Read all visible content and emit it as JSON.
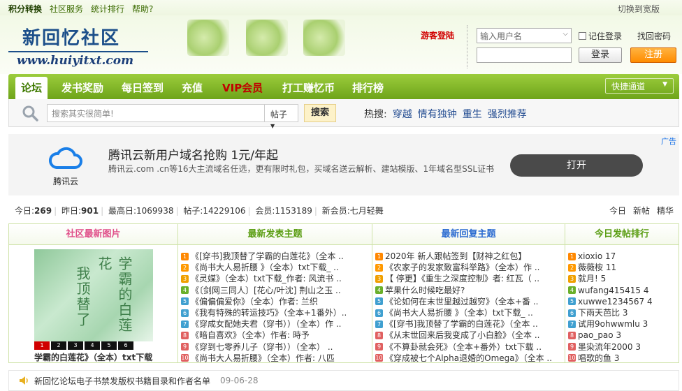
{
  "topbar": {
    "links": [
      "积分转换",
      "社区服务",
      "统计排行",
      "帮助?"
    ],
    "switch_label": "切换到宽版"
  },
  "logo": {
    "cn": "新回忆社区",
    "url": "www.huiyitxt.com"
  },
  "guest_login": "游客登陆",
  "login": {
    "username_placeholder": "输入用户名",
    "remember_label": "记住登录",
    "find_password": "找回密码",
    "login_button": "登录",
    "register_button": "注册"
  },
  "nav": {
    "items": [
      "论坛",
      "发书奖励",
      "每日签到",
      "充值",
      "VIP会员",
      "打工赚忆币",
      "排行榜"
    ],
    "quick_label": "快捷通道"
  },
  "search": {
    "placeholder": "搜索其实很简单!",
    "type_label": "帖子",
    "button": "搜索",
    "hot_label": "热搜:",
    "hot_keywords": [
      "穿越",
      "情有独钟",
      "重生",
      "强烈推荐"
    ]
  },
  "ad": {
    "tag": "广告",
    "brand": "腾讯云",
    "title": "腾讯云新用户域名抢购 1元/年起",
    "desc": "腾讯云.com .cn等16大主流域名任选，更有限时礼包，买域名送云解析、建站模版、1年域名型SSL证书",
    "open_button": "打开",
    "brand_color": "#1a7fe8"
  },
  "stats": {
    "today_label": "今日:",
    "today": "269",
    "yesterday_label": "昨日:",
    "yesterday": "901",
    "max_label": "最高日:",
    "max": "1069938",
    "posts_label": "帖子:",
    "posts": "14229106",
    "members_label": "会员:",
    "members": "1153189",
    "newest_label": "新会员:",
    "newest": "七月轻舞",
    "right_links": [
      "今日",
      "新帖",
      "精华"
    ]
  },
  "board": {
    "heads": [
      "社区最新图片",
      "最新发表主题",
      "最新回复主题",
      "今日发帖排行"
    ],
    "pic_title_1": "学霸的白莲花",
    "pic_title_2": "我顶替了",
    "pic_caption": "学霸的白莲花》（全本）txt下载",
    "pager": [
      "1",
      "2",
      "3",
      "4",
      "5",
      "6"
    ],
    "new_topics": [
      "《[穿书]我顶替了学霸的白莲花》（全本 ..",
      "《尚书大人易折腰 》（全本）txt下载_ ..",
      "《灵媒》（全本）txt下载_作者: 风流书 ..",
      "《〔剑网三同人〕[花心/叶沈] 荆山之玉 ..",
      "《偏偏偏爱你》（全本）作者: 兰织",
      "《我有特殊的转运技巧》（全本+1番外）..",
      "《穿成女配她夫君（穿书））（全本）作 ..",
      "《暗自喜欢》（全本）作者: 時予",
      "《穿到七零养儿子（穿书））（全本） ..",
      "《尚书大人易折腰》（全本）作者: 八匹"
    ],
    "new_replies": [
      "2020年 新人跟帖签到【财神之红包】",
      "《农家子的发家致富科举路》（全本）作 ..",
      "【 停更】《重生之深度控制》者: 红瓦（ ..",
      "苹果什么时候吃最好?",
      "《论如何在末世里越过越穷》（全本+番 ..",
      "《尚书大人易折腰 》（全本）txt下载_ ..",
      "《[穿书]我顶替了学霸的白莲花》（全本 ..",
      "《从末世回来后我变成了小白脸》（全本 ..",
      "《不算卦就会死》（全本+番外）txt下载 ..",
      "《穿成被七个Alpha退婚的Omega》（全本 .."
    ],
    "ranking": [
      "xioxio 17",
      "薇薇桉 11",
      "就月! 5",
      "wufang415415 4",
      "xuwwe1234567 4",
      "下雨天芭比 3",
      "试用9ohwwmlu 3",
      "pao_pao 3",
      "墨染流年2000 3",
      "唱歌的鱼 3"
    ]
  },
  "notice": {
    "text": "新回忆论坛电子书禁发版权书籍目录和作者名单",
    "date": "09-06-28"
  }
}
